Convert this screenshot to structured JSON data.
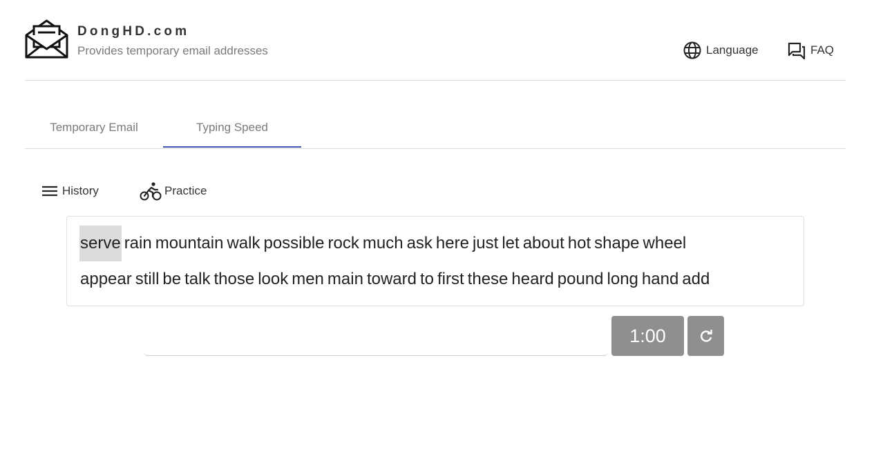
{
  "header": {
    "brand_name": "DongHD.com",
    "tagline": "Provides temporary email addresses",
    "language_label": "Language",
    "faq_label": "FAQ"
  },
  "tabs": [
    {
      "label": "Temporary Email",
      "active": false
    },
    {
      "label": "Typing Speed",
      "active": true
    }
  ],
  "subnav": {
    "history_label": "History",
    "practice_label": "Practice"
  },
  "typing": {
    "current_word_index": 0,
    "lines": [
      [
        "serve",
        "rain",
        "mountain",
        "walk",
        "possible",
        "rock",
        "much",
        "ask",
        "here",
        "just",
        "let",
        "about",
        "hot",
        "shape",
        "wheel"
      ],
      [
        "appear",
        "still",
        "be",
        "talk",
        "those",
        "look",
        "men",
        "main",
        "toward",
        "to",
        "first",
        "these",
        "heard",
        "pound",
        "long",
        "hand",
        "add"
      ]
    ],
    "input_value": "",
    "timer": "1:00"
  },
  "icons": {
    "logo": "envelope-open-icon",
    "language": "globe-icon",
    "faq": "forum-icon",
    "history": "menu-icon",
    "practice": "bike-icon",
    "reset": "refresh-icon"
  },
  "colors": {
    "accent": "#3f51b5",
    "control_bg": "#8f8f8f",
    "highlight": "#dcdcdc"
  }
}
